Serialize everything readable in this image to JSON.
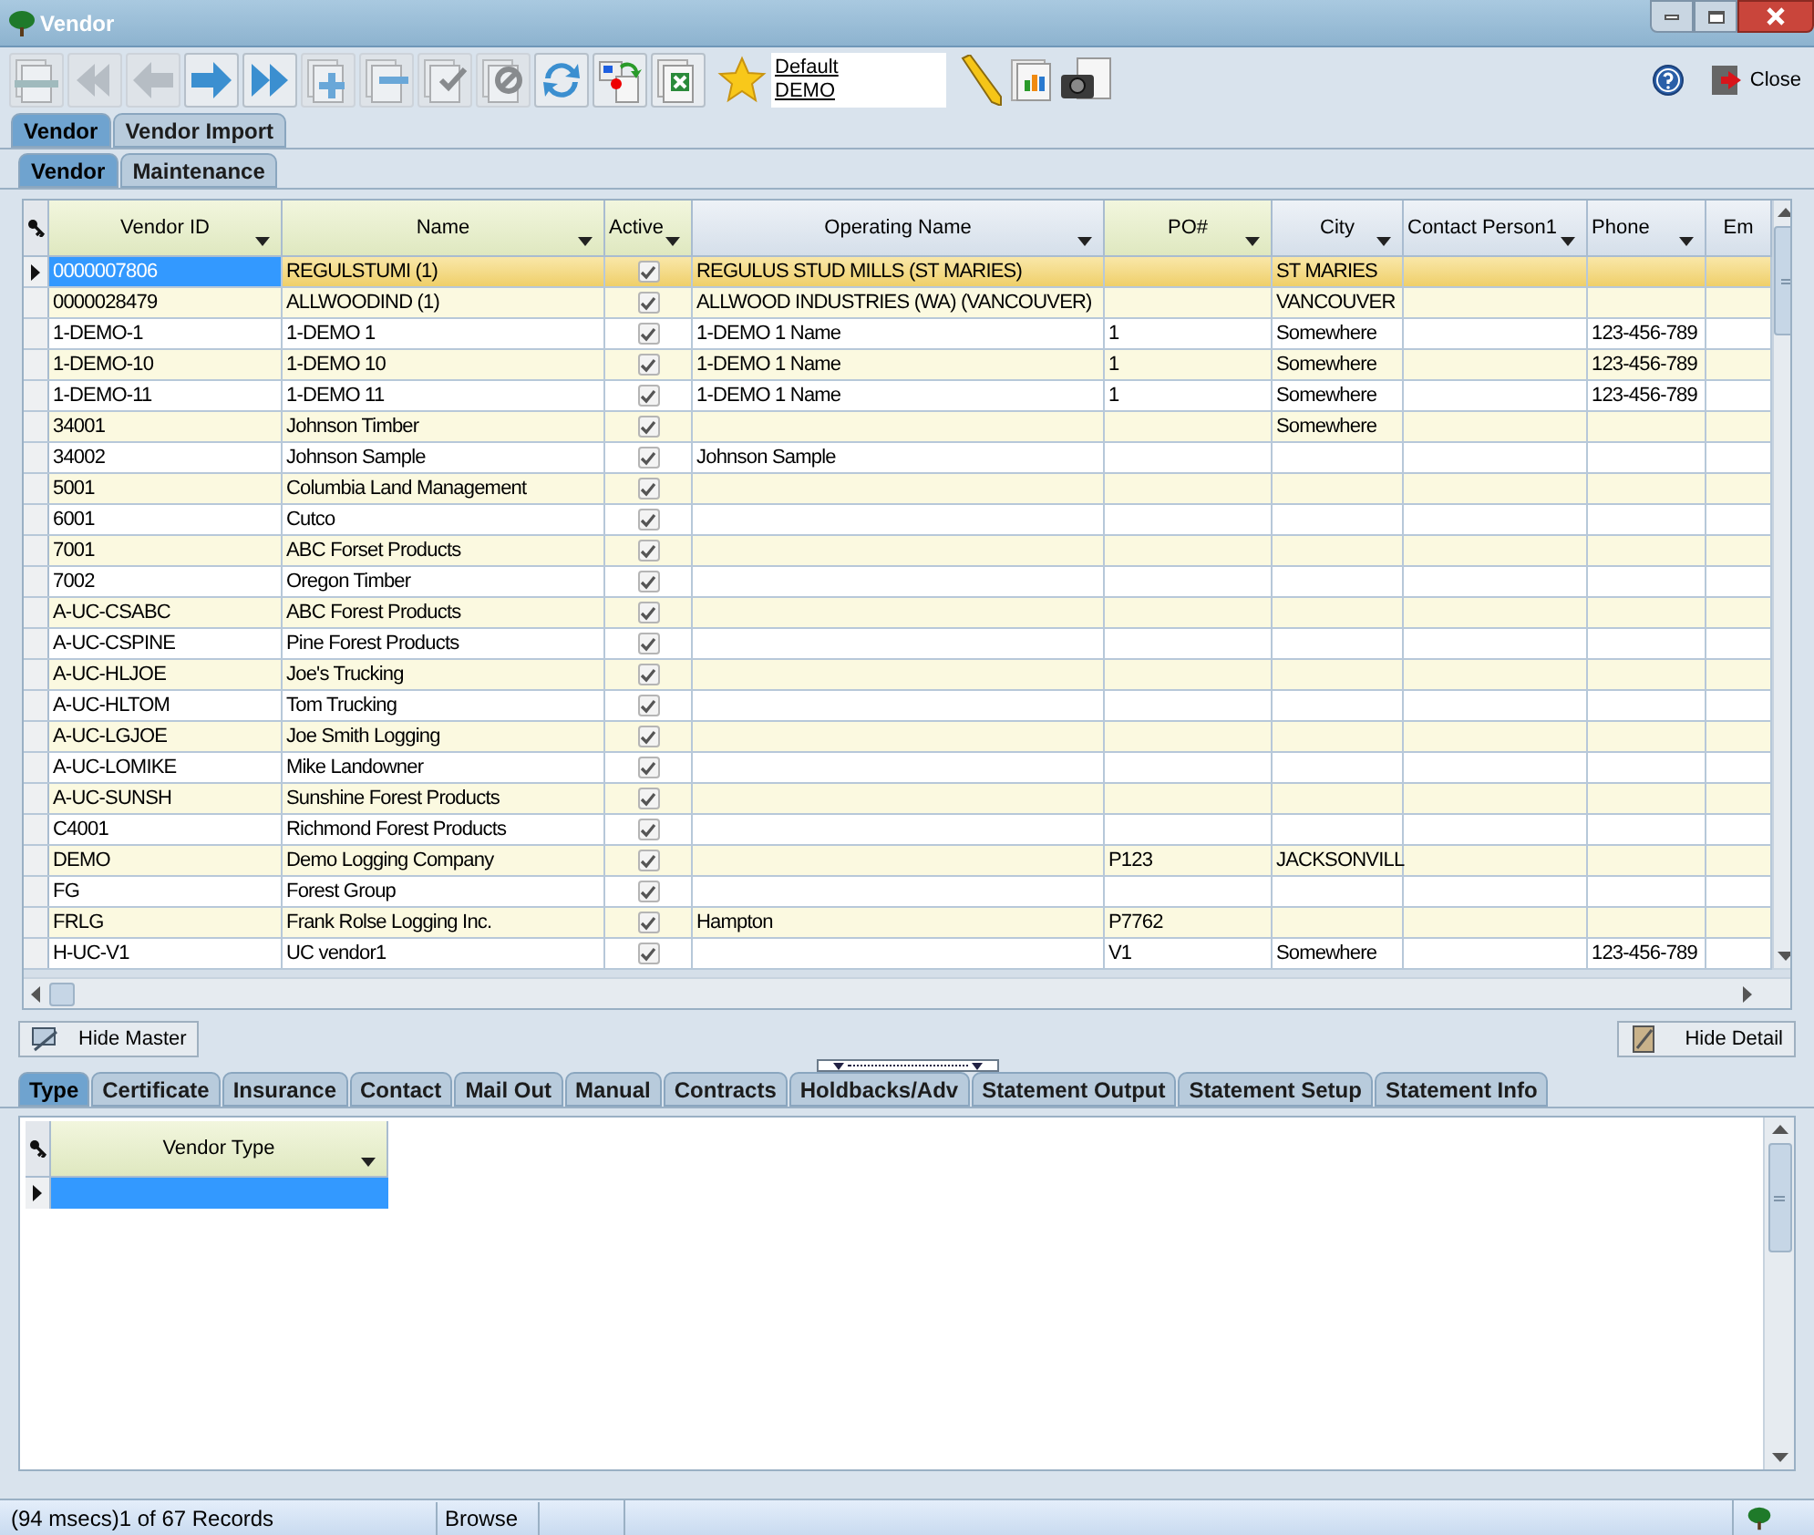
{
  "window": {
    "title": "Vendor"
  },
  "toolbar": [
    {
      "kind": "doc-minus",
      "disabled": true
    },
    {
      "kind": "first",
      "disabled": true
    },
    {
      "kind": "prev",
      "disabled": true
    },
    {
      "kind": "next",
      "disabled": false
    },
    {
      "kind": "last",
      "disabled": false
    },
    {
      "kind": "add",
      "disabled": true
    },
    {
      "kind": "delete",
      "disabled": true
    },
    {
      "kind": "post",
      "disabled": true
    },
    {
      "kind": "cancel",
      "disabled": true
    },
    {
      "kind": "refresh",
      "disabled": false
    },
    {
      "kind": "switch",
      "disabled": false
    },
    {
      "kind": "excel",
      "disabled": false
    }
  ],
  "layout_links": [
    "Default",
    "DEMO"
  ],
  "close_label": "Close",
  "top_tabs": [
    {
      "label": "Vendor",
      "selected": true
    },
    {
      "label": "Vendor Import",
      "selected": false
    }
  ],
  "sub_tabs": [
    {
      "label": "Vendor",
      "selected": true
    },
    {
      "label": "Maintenance",
      "selected": false
    }
  ],
  "table": {
    "columns": [
      {
        "label": "Vendor ID",
        "highlighted": true
      },
      {
        "label": "Name",
        "highlighted": true
      },
      {
        "label": "Active",
        "highlighted": true
      },
      {
        "label": "Operating Name",
        "highlighted": false
      },
      {
        "label": "PO#",
        "highlighted": true
      },
      {
        "label": "City",
        "highlighted": false
      },
      {
        "label": "Contact Person1",
        "highlighted": false
      },
      {
        "label": "Phone",
        "highlighted": false
      },
      {
        "label": "Em",
        "highlighted": false
      }
    ],
    "rows": [
      {
        "selected": true,
        "vendor_id": "0000007806",
        "name": "REGULSTUMI (1)",
        "active": true,
        "operating_name": "REGULUS STUD MILLS (ST MARIES)",
        "city": "ST MARIES"
      },
      {
        "selected": false,
        "vendor_id": "0000028479",
        "name": "ALLWOODIND (1)",
        "active": true,
        "operating_name": "ALLWOOD INDUSTRIES (WA) (VANCOUVER)",
        "city": "VANCOUVER"
      },
      {
        "selected": false,
        "vendor_id": "1-DEMO-1",
        "name": "1-DEMO 1",
        "active": true,
        "operating_name": "1-DEMO 1 Name",
        "po": "1",
        "city": "Somewhere",
        "phone": "123-456-789"
      },
      {
        "selected": false,
        "vendor_id": "1-DEMO-10",
        "name": "1-DEMO 10",
        "active": true,
        "operating_name": "1-DEMO 1 Name",
        "po": "1",
        "city": "Somewhere",
        "phone": "123-456-789"
      },
      {
        "selected": false,
        "vendor_id": "1-DEMO-11",
        "name": "1-DEMO 11",
        "active": true,
        "operating_name": "1-DEMO 1 Name",
        "po": "1",
        "city": "Somewhere",
        "phone": "123-456-789"
      },
      {
        "selected": false,
        "vendor_id": "34001",
        "name": "Johnson Timber",
        "active": true,
        "city": "Somewhere"
      },
      {
        "selected": false,
        "vendor_id": "34002",
        "name": "Johnson Sample",
        "active": true,
        "operating_name": "Johnson Sample"
      },
      {
        "selected": false,
        "vendor_id": "5001",
        "name": "Columbia Land Management",
        "active": true
      },
      {
        "selected": false,
        "vendor_id": "6001",
        "name": "Cutco",
        "active": true
      },
      {
        "selected": false,
        "vendor_id": "7001",
        "name": "ABC Forset Products",
        "active": true
      },
      {
        "selected": false,
        "vendor_id": "7002",
        "name": "Oregon Timber",
        "active": true
      },
      {
        "selected": false,
        "vendor_id": "A-UC-CSABC",
        "name": "ABC Forest Products",
        "active": true
      },
      {
        "selected": false,
        "vendor_id": "A-UC-CSPINE",
        "name": "Pine Forest Products",
        "active": true
      },
      {
        "selected": false,
        "vendor_id": "A-UC-HLJOE",
        "name": "Joe's Trucking",
        "active": true
      },
      {
        "selected": false,
        "vendor_id": "A-UC-HLTOM",
        "name": "Tom Trucking",
        "active": true
      },
      {
        "selected": false,
        "vendor_id": "A-UC-LGJOE",
        "name": "Joe Smith Logging",
        "active": true
      },
      {
        "selected": false,
        "vendor_id": "A-UC-LOMIKE",
        "name": "Mike Landowner",
        "active": true
      },
      {
        "selected": false,
        "vendor_id": "A-UC-SUNSH",
        "name": "Sunshine Forest Products",
        "active": true
      },
      {
        "selected": false,
        "vendor_id": "C4001",
        "name": "Richmond Forest Products",
        "active": true
      },
      {
        "selected": false,
        "vendor_id": "DEMO",
        "name": "Demo Logging Company",
        "active": true,
        "po": "P123",
        "city": "JACKSONVILL"
      },
      {
        "selected": false,
        "vendor_id": "FG",
        "name": "Forest Group",
        "active": true
      },
      {
        "selected": false,
        "vendor_id": "FRLG",
        "name": "Frank Rolse Logging Inc.",
        "active": true,
        "operating_name": "Hampton",
        "po": "P7762"
      },
      {
        "selected": false,
        "vendor_id": "H-UC-V1",
        "name": "UC vendor1",
        "active": true,
        "po": "V1",
        "city": "Somewhere",
        "phone": "123-456-789"
      }
    ]
  },
  "hide_master": "Hide Master",
  "hide_detail": "Hide Detail",
  "detail_tabs": [
    {
      "label": "Type",
      "selected": true
    },
    {
      "label": "Certificate",
      "selected": false
    },
    {
      "label": "Insurance",
      "selected": false
    },
    {
      "label": "Contact",
      "selected": false
    },
    {
      "label": "Mail Out",
      "selected": false
    },
    {
      "label": "Manual",
      "selected": false
    },
    {
      "label": "Contracts",
      "selected": false
    },
    {
      "label": "Holdbacks/Adv",
      "selected": false
    },
    {
      "label": "Statement Output",
      "selected": false
    },
    {
      "label": "Statement Setup",
      "selected": false
    },
    {
      "label": "Statement Info",
      "selected": false
    }
  ],
  "detail_table": {
    "columns": [
      {
        "label": "Vendor Type"
      }
    ],
    "rows": [
      {
        "selected": true
      }
    ]
  },
  "status_bar": [
    "(94 msecs)1 of 67 Records",
    "Browse"
  ]
}
